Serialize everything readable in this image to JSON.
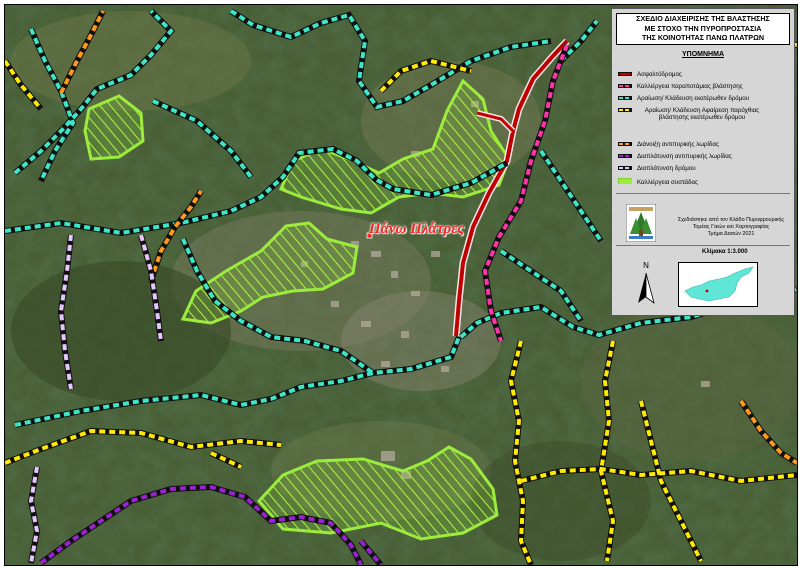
{
  "map": {
    "village_label": "Πάνω Πλάτρες"
  },
  "legend": {
    "title_lines": [
      "ΣΧΕΔΙΟ ΔΙΑΧΕΙΡΙΣΗΣ ΤΗΣ ΒΛΑΣΤΗΣΗΣ",
      "ΜΕ ΣΤΟΧΟ ΤΗΝ ΠΥΡΟΠΡΟΣΤΑΣΙΑ",
      "ΤΗΣ ΚΟΙΝΟΤΗΤΑΣ ΠΑΝΩ ΠΛΑΤΡΩΝ"
    ],
    "heading": "ΥΠΟΜΝΗΜΑ",
    "items": [
      {
        "label": "Ασφαλτόδρομος",
        "color": "#c00000",
        "style": "road"
      },
      {
        "label": "Καλλιέργεια παραποτάμιας βλάστησης",
        "color": "#ff33aa",
        "style": "dashed"
      },
      {
        "label": "Αραίωση/ Κλάδευση εκατέρωθεν δρόμου",
        "color": "#3ee6c8",
        "style": "dashed"
      },
      {
        "label": "Αραίωση/ Κλάδευση Αφαίρεση παρόχθιας βλάστησης εκατέρωθεν δρόμου",
        "color": "#ffea00",
        "style": "dashed"
      },
      {
        "label": "Διάνοιξη αντιπυρικής λωρίδας",
        "color": "#ff9a1a",
        "style": "dashed"
      },
      {
        "label": "Διαπλάτυνση αντιπυρικής λωρίδας",
        "color": "#9a22d0",
        "style": "dashed"
      },
      {
        "label": "Διαπλάτυνση δρόμου",
        "color": "#e6c6ff",
        "style": "dashed"
      },
      {
        "label": "Καλλιέργεια συστάδας",
        "color": "#9bec3c",
        "style": "area"
      }
    ],
    "credit_lines": [
      "Σχεδιάστηκε από τον Κλάδο Πυροφρουρικής",
      "Τομέας Γαιών και Χαρτογραφίας",
      "Τμήμα Δασών 2021"
    ],
    "scale": "Κλίμακα 1:3.000",
    "north_label": "N"
  }
}
